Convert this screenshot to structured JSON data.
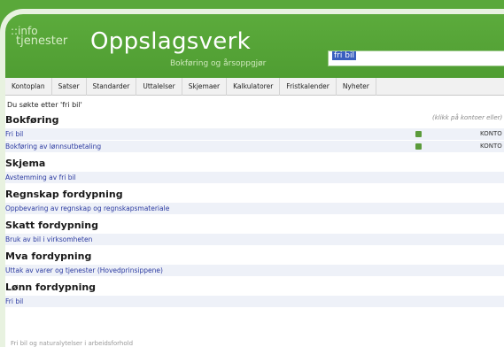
{
  "header": {
    "logo_line1": "::info",
    "logo_line2": "tjenester",
    "title": "Oppslagsverk",
    "subtitle": "Bokføring og årsoppgjør"
  },
  "search": {
    "value": "fri bil"
  },
  "menu": [
    "Kontoplan",
    "Satser",
    "Standarder",
    "Uttalelser",
    "Skjemaer",
    "Kalkulatorer",
    "Fristkalender",
    "Nyheter"
  ],
  "result_note": "Du søkte etter 'fri bil'",
  "hint": "(klikk på kontoer eller)",
  "sections": [
    {
      "title": "Bokføring",
      "rows": [
        {
          "label": "Fri bil",
          "kind": "KONTO",
          "icon": "table-icon"
        },
        {
          "label": "Bokføring av lønnsutbetaling",
          "kind": "KONTO",
          "icon": "table-icon"
        }
      ]
    },
    {
      "title": "Skjema",
      "rows": [
        {
          "label": "Avstemming av fri bil"
        }
      ]
    },
    {
      "title": "Regnskap fordypning",
      "rows": [
        {
          "label": "Oppbevaring av regnskap og regnskapsmateriale"
        }
      ]
    },
    {
      "title": "Skatt fordypning",
      "rows": [
        {
          "label": "Bruk av bil i virksomheten"
        }
      ]
    },
    {
      "title": "Mva fordypning",
      "rows": [
        {
          "label": "Uttak av varer og tjenester (Hovedprinsippene)"
        }
      ]
    },
    {
      "title": "Lønn fordypning",
      "rows": [
        {
          "label": "Fri bil"
        }
      ]
    }
  ],
  "footer_text": "Fri bil og naturalytelser i arbeidsforhold",
  "colors": {
    "brand_green": "#5aa83a",
    "link_blue": "#2b3aa0",
    "row_bg": "#eef1f8"
  }
}
